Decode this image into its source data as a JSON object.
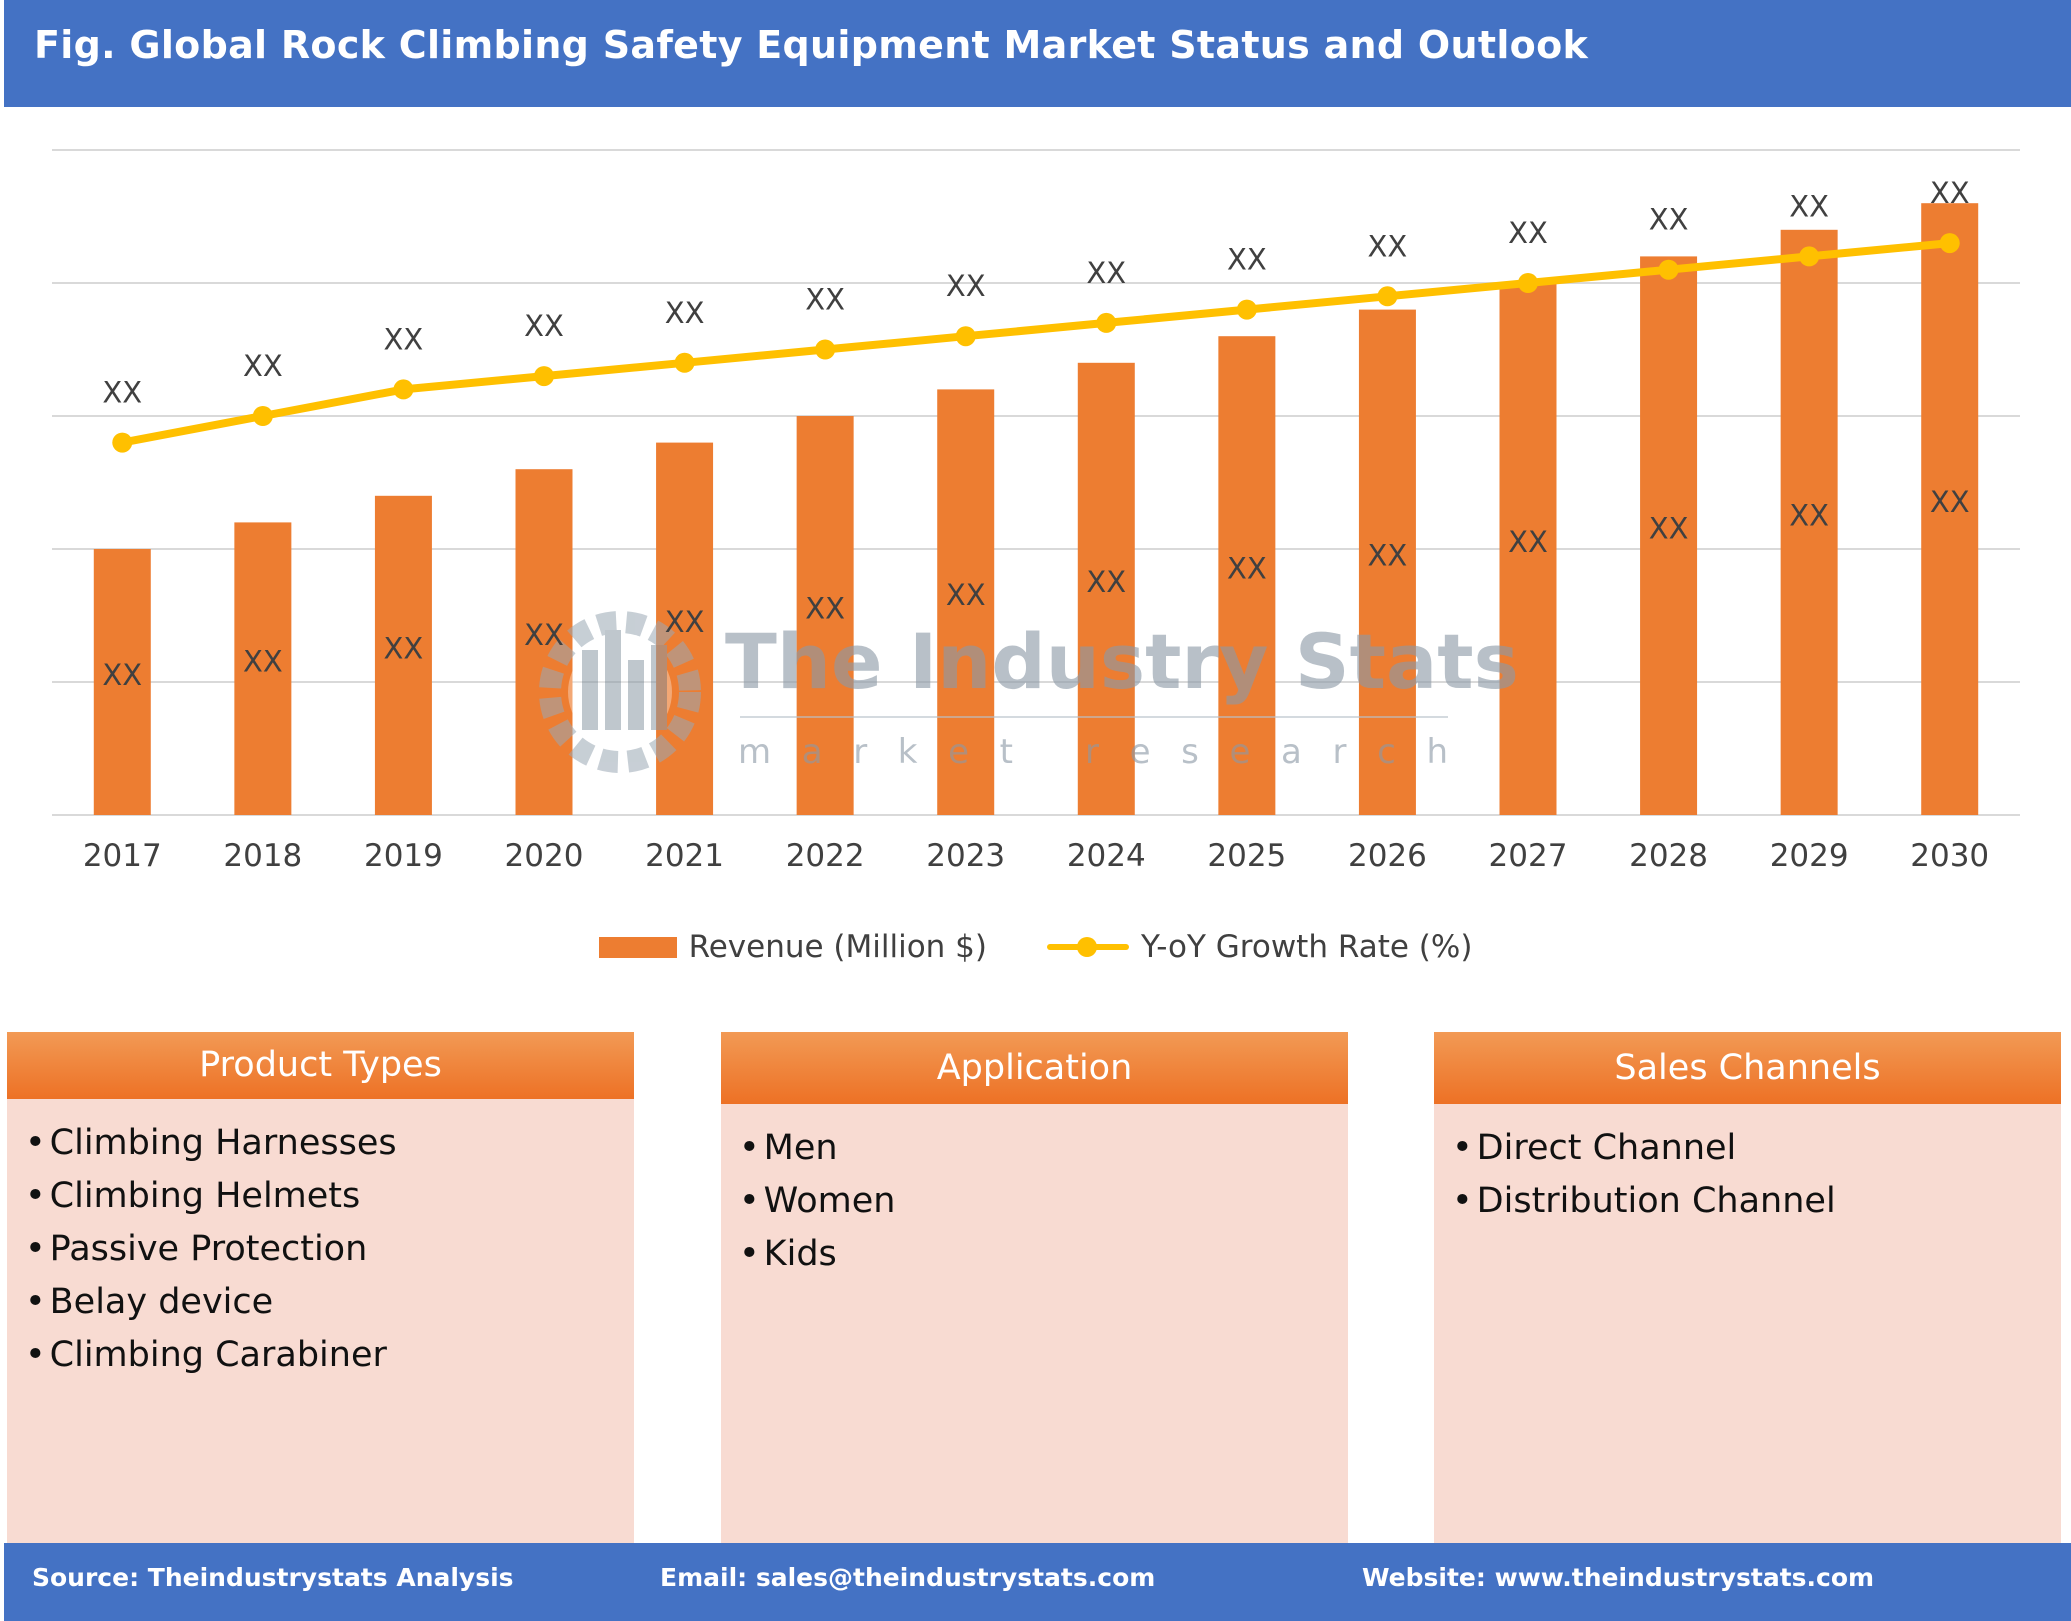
{
  "title": "Fig. Global Rock Climbing Safety Equipment Market Status and Outlook",
  "colors": {
    "header_bg": "#4472c4",
    "bar": "#ed7d31",
    "line": "#ffc000",
    "panel_header": "#ed7125",
    "panel_body": "#f8dbd2",
    "watermark": "#8c9aa6"
  },
  "watermark": {
    "icon": "gear-factory-logo-icon",
    "name": "The Industry Stats",
    "tagline": "m a r k e t   r e s e a r c h"
  },
  "chart_data": {
    "type": "bar",
    "categories": [
      "2017",
      "2018",
      "2019",
      "2020",
      "2021",
      "2022",
      "2023",
      "2024",
      "2025",
      "2026",
      "2027",
      "2028",
      "2029",
      "2030"
    ],
    "ylim": [
      0,
      5
    ],
    "grid": true,
    "legend_position": "bottom",
    "series": [
      {
        "name": "Revenue (Million $)",
        "type": "bar",
        "values": [
          2.0,
          2.2,
          2.4,
          2.6,
          2.8,
          3.0,
          3.2,
          3.4,
          3.6,
          3.8,
          4.0,
          4.2,
          4.4,
          4.6
        ],
        "data_labels": [
          "XX",
          "XX",
          "XX",
          "XX",
          "XX",
          "XX",
          "XX",
          "XX",
          "XX",
          "XX",
          "XX",
          "XX",
          "XX",
          "XX"
        ]
      },
      {
        "name": "Y-oY Growth Rate (%)",
        "type": "line",
        "values": [
          2.8,
          3.0,
          3.2,
          3.3,
          3.4,
          3.5,
          3.6,
          3.7,
          3.8,
          3.9,
          4.0,
          4.1,
          4.2,
          4.3
        ],
        "data_labels": [
          "XX",
          "XX",
          "XX",
          "XX",
          "XX",
          "XX",
          "XX",
          "XX",
          "XX",
          "XX",
          "XX",
          "XX",
          "XX",
          "XX"
        ]
      }
    ]
  },
  "panels": [
    {
      "title": "Product Types",
      "items": [
        "Climbing Harnesses",
        "Climbing Helmets",
        "Passive Protection",
        "Belay device",
        "Climbing Carabiner"
      ]
    },
    {
      "title": "Application",
      "items": [
        "Men",
        "Women",
        "Kids"
      ]
    },
    {
      "title": "Sales Channels",
      "items": [
        "Direct Channel",
        "Distribution Channel"
      ]
    }
  ],
  "footer": {
    "source": "Source: Theindustrystats Analysis",
    "email": "Email: sales@theindustrystats.com",
    "website": "Website: www.theindustrystats.com"
  }
}
